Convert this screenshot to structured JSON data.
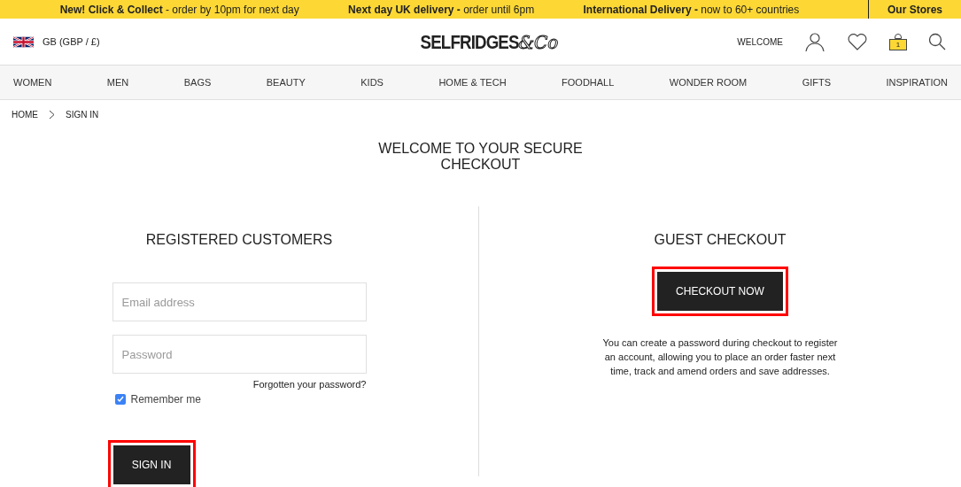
{
  "promo_bar": {
    "items": [
      "**New! Click & Collect** - order by 10pm for next day",
      "**Next day UK delivery -** order until 6pm",
      "**International Delivery -** now to 60+ countries"
    ],
    "stores_link": "Our Stores"
  },
  "header": {
    "region": "GB (GBP / £)",
    "logo": {
      "name": "SELFRIDGES",
      "suffix": "&Co"
    },
    "welcome": "WELCOME",
    "bag_count": "1"
  },
  "nav": [
    "WOMEN",
    "MEN",
    "BAGS",
    "BEAUTY",
    "KIDS",
    "HOME & TECH",
    "FOODHALL",
    "WONDER ROOM",
    "GIFTS",
    "INSPIRATION"
  ],
  "breadcrumb": [
    "HOME",
    "SIGN IN"
  ],
  "page_title": "WELCOME TO YOUR SECURE CHECKOUT",
  "registered": {
    "heading": "REGISTERED CUSTOMERS",
    "email_placeholder": "Email address",
    "password_placeholder": "Password",
    "forgot_link": "Forgotten your password?",
    "remember": {
      "label": "Remember me",
      "checked": true
    },
    "button": {
      "label": "SIGN IN",
      "highlighted": true
    }
  },
  "guest": {
    "heading": "GUEST CHECKOUT",
    "button": {
      "label": "CHECKOUT NOW",
      "highlighted": true
    },
    "note": "You can create a password during checkout to register an account, allowing you to place an order faster next time, track and amend orders and save addresses."
  }
}
